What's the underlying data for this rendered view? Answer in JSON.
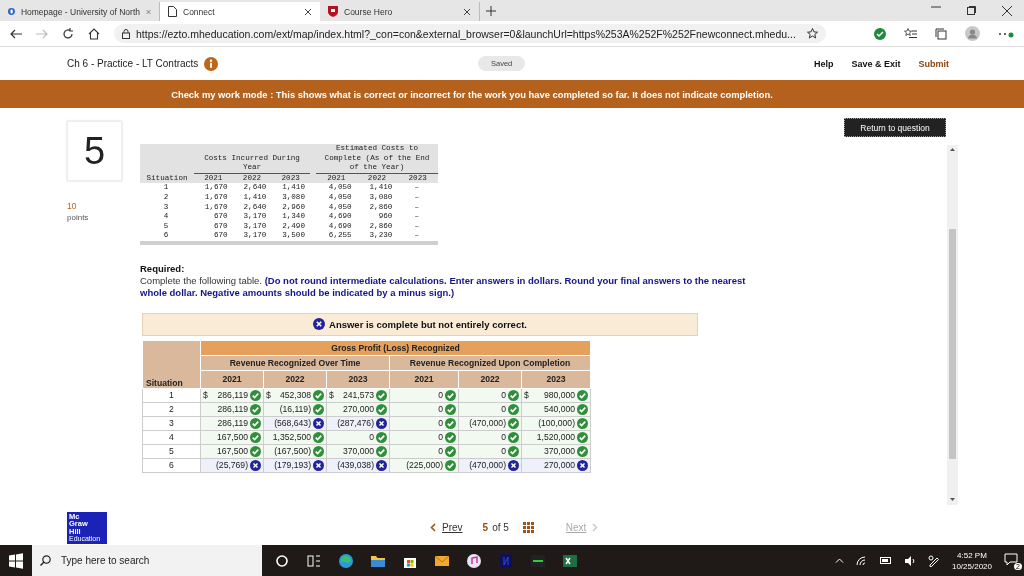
{
  "browser": {
    "tabs": [
      {
        "title": "Homepage - University of North",
        "selected": false,
        "kind": "school"
      },
      {
        "title": "Connect",
        "selected": true,
        "kind": "page"
      },
      {
        "title": "Course Hero",
        "selected": false,
        "kind": "shield"
      }
    ],
    "forward": {
      "disabled": true
    },
    "url": "https://ezto.mheducation.com/ext/map/index.html?_con=con&external_browser=0&launchUrl=https%253A%252F%252Fnewconnect.mhedu..."
  },
  "header": {
    "title": "Ch 6 - Practice - LT Contracts",
    "status": "Saved",
    "links": [
      "Help",
      "Save & Exit",
      "Submit"
    ]
  },
  "banner": "Check my work mode : This shows what is correct or incorrect for the work you have completed so far. It does not indicate completion.",
  "question": {
    "number": "5",
    "points": "10",
    "points_label": "points"
  },
  "return_button": "Return to question",
  "cost_table": {
    "group_headers": [
      "Costs Incurred During Year",
      "Estimated Costs to Complete (As of the End of the Year)"
    ],
    "situation_header": "Situation",
    "years": [
      "2021",
      "2022",
      "2023",
      "2021",
      "2022",
      "2023"
    ],
    "rows": [
      [
        "1",
        "1,670",
        "2,640",
        "1,410",
        "4,050",
        "1,410",
        "–"
      ],
      [
        "2",
        "1,670",
        "1,410",
        "3,080",
        "4,050",
        "3,080",
        "–"
      ],
      [
        "3",
        "1,670",
        "2,640",
        "2,960",
        "4,050",
        "2,860",
        "–"
      ],
      [
        "4",
        "670",
        "3,170",
        "1,340",
        "4,690",
        "960",
        "–"
      ],
      [
        "5",
        "670",
        "3,170",
        "2,490",
        "4,690",
        "2,860",
        "–"
      ],
      [
        "6",
        "670",
        "3,170",
        "3,500",
        "6,255",
        "3,230",
        "–"
      ]
    ]
  },
  "required": {
    "heading": "Required:",
    "instruction": "Complete the following table. **(Do not round intermediate calculations. Enter answers in dollars. Round your final answers to the nearest whole dollar. Negative amounts should be indicated by a minus sign.)**"
  },
  "result": {
    "text": "Answer is complete but not entirely correct.",
    "correct": false
  },
  "answer_table": {
    "title": "Gross Profit (Loss) Recognized",
    "groups": [
      "Revenue Recognized Over Time",
      "Revenue Recognized Upon Completion"
    ],
    "situation_header": "Situation",
    "years": [
      "2021",
      "2022",
      "2023",
      "2021",
      "2022",
      "2023"
    ],
    "rows": [
      {
        "situation": "1",
        "cells": [
          {
            "prefix": "$",
            "value": "286,119",
            "correct": true
          },
          {
            "prefix": "$",
            "value": "452,308",
            "correct": true
          },
          {
            "prefix": "$",
            "value": "241,573",
            "correct": true
          },
          {
            "value": "0",
            "correct": true
          },
          {
            "value": "0",
            "correct": true
          },
          {
            "prefix": "$",
            "value": "980,000",
            "correct": true
          }
        ]
      },
      {
        "situation": "2",
        "cells": [
          {
            "value": "286,119",
            "correct": true
          },
          {
            "value": "(16,119)",
            "correct": true
          },
          {
            "value": "270,000",
            "correct": true
          },
          {
            "value": "0",
            "correct": true
          },
          {
            "value": "0",
            "correct": true
          },
          {
            "value": "540,000",
            "correct": true
          }
        ]
      },
      {
        "situation": "3",
        "cells": [
          {
            "value": "286,119",
            "correct": true
          },
          {
            "value": "(568,643)",
            "correct": false
          },
          {
            "value": "(287,476)",
            "correct": false
          },
          {
            "value": "0",
            "correct": true
          },
          {
            "value": "(470,000)",
            "correct": true
          },
          {
            "value": "(100,000)",
            "correct": true
          }
        ]
      },
      {
        "situation": "4",
        "cells": [
          {
            "value": "167,500",
            "correct": true
          },
          {
            "value": "1,352,500",
            "correct": true
          },
          {
            "value": "0",
            "correct": true
          },
          {
            "value": "0",
            "correct": true
          },
          {
            "value": "0",
            "correct": true
          },
          {
            "value": "1,520,000",
            "correct": true
          }
        ]
      },
      {
        "situation": "5",
        "cells": [
          {
            "value": "167,500",
            "correct": true
          },
          {
            "value": "(167,500)",
            "correct": true
          },
          {
            "value": "370,000",
            "correct": true
          },
          {
            "value": "0",
            "correct": true
          },
          {
            "value": "0",
            "correct": true
          },
          {
            "value": "370,000",
            "correct": true
          }
        ]
      },
      {
        "situation": "6",
        "cells": [
          {
            "value": "(25,769)",
            "correct": false
          },
          {
            "value": "(179,193)",
            "correct": false
          },
          {
            "value": "(439,038)",
            "correct": false
          },
          {
            "value": "(225,000)",
            "correct": true
          },
          {
            "value": "(470,000)",
            "correct": false
          },
          {
            "value": "270,000",
            "correct": false
          }
        ]
      }
    ]
  },
  "logo": [
    "Mc",
    "Graw",
    "Hill",
    "Education"
  ],
  "nav": {
    "prev": {
      "label": "Prev",
      "disabled": false
    },
    "page": "5",
    "of": "of 5",
    "next": {
      "label": "Next",
      "disabled": true
    }
  },
  "taskbar": {
    "search_placeholder": "Type here to search",
    "time": "4:52 PM",
    "date": "10/25/2020",
    "notifications": "2"
  }
}
